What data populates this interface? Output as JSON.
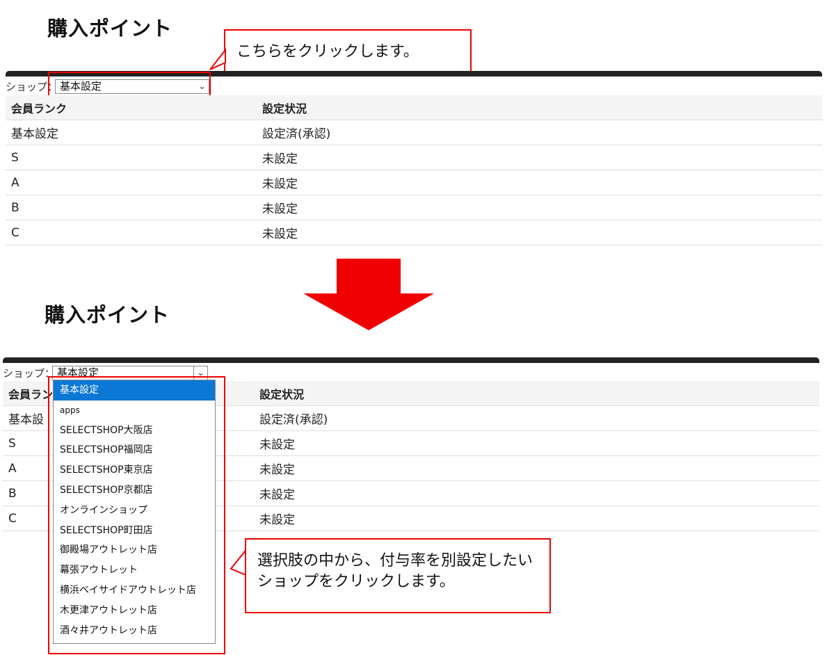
{
  "top": {
    "title": "購入ポイント",
    "callout": "こちらをクリックします。",
    "shop_label": "ショップ：",
    "shop_selected": "基本設定",
    "columns": [
      "会員ランク",
      "設定状況"
    ],
    "rows": [
      [
        "基本設定",
        "設定済(承認)"
      ],
      [
        "S",
        "未設定"
      ],
      [
        "A",
        "未設定"
      ],
      [
        "B",
        "未設定"
      ],
      [
        "C",
        "未設定"
      ]
    ]
  },
  "bottom": {
    "title": "購入ポイント",
    "shop_label": "ショップ：",
    "shop_selected": "基本設定",
    "columns": [
      "会員ラン",
      "設定状況"
    ],
    "rows": [
      [
        "基本設",
        "設定済(承認)"
      ],
      [
        "S",
        "未設定"
      ],
      [
        "A",
        "未設定"
      ],
      [
        "B",
        "未設定"
      ],
      [
        "C",
        "未設定"
      ]
    ],
    "dropdown_options": [
      "基本設定",
      "apps",
      "SELECTSHOP大阪店",
      "SELECTSHOP福岡店",
      "SELECTSHOP東京店",
      "SELECTSHOP京都店",
      "オンラインショップ",
      "SELECTSHOP町田店",
      "御殿場アウトレット店",
      "幕張アウトレット",
      "横浜ベイサイドアウトレット店",
      "木更津アウトレット店",
      "酒々井アウトレット店"
    ],
    "callout": "選択肢の中から、付与率を別設定したいショップをクリックします。"
  },
  "colors": {
    "accent_red": "#e00000",
    "selected_option": "#0a78d4",
    "header_bar": "#222222"
  },
  "icons": {
    "select_chevron": "chevron-down-icon",
    "transition_arrow": "down-arrow-icon"
  }
}
